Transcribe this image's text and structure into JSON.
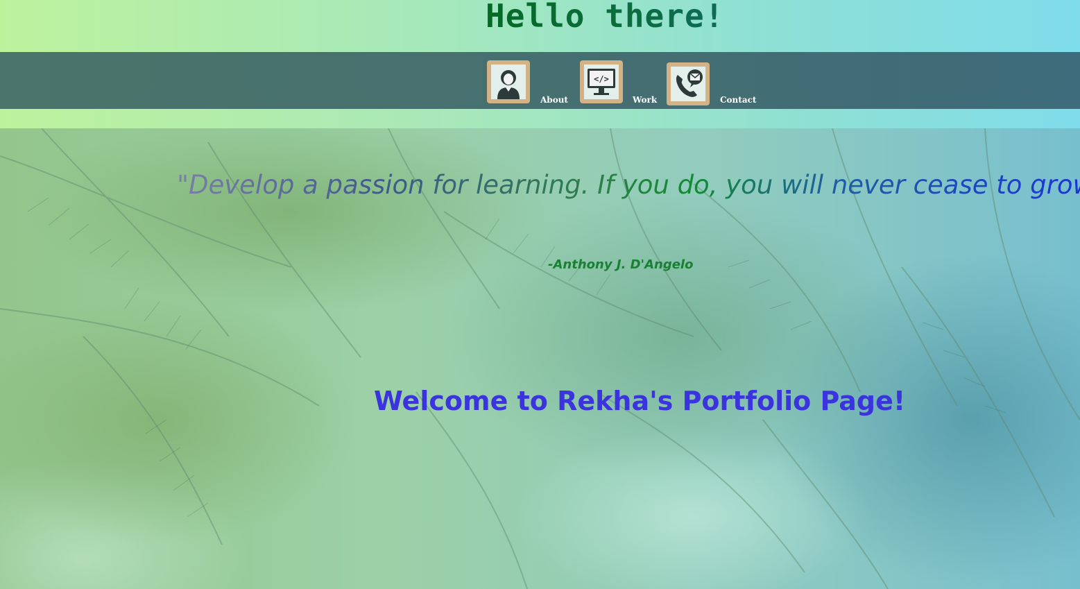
{
  "header": {
    "title": "Hello there!"
  },
  "nav": {
    "items": [
      {
        "label": "About",
        "icon": "person-icon"
      },
      {
        "label": "Work",
        "icon": "code-monitor-icon"
      },
      {
        "label": "Contact",
        "icon": "phone-mail-icon"
      }
    ]
  },
  "hero": {
    "quote": "\"Develop a passion for learning. If you do, you will never cease to grow.\"",
    "author": "-Anthony J. D'Angelo",
    "welcome": "Welcome to Rekha's Portfolio Page!"
  },
  "colors": {
    "navbar": "#46706f",
    "icon_frame": "#d3b285",
    "title_green": "#0c6d3c",
    "welcome_blue": "#3b33dd",
    "author_green": "#1a8033"
  }
}
